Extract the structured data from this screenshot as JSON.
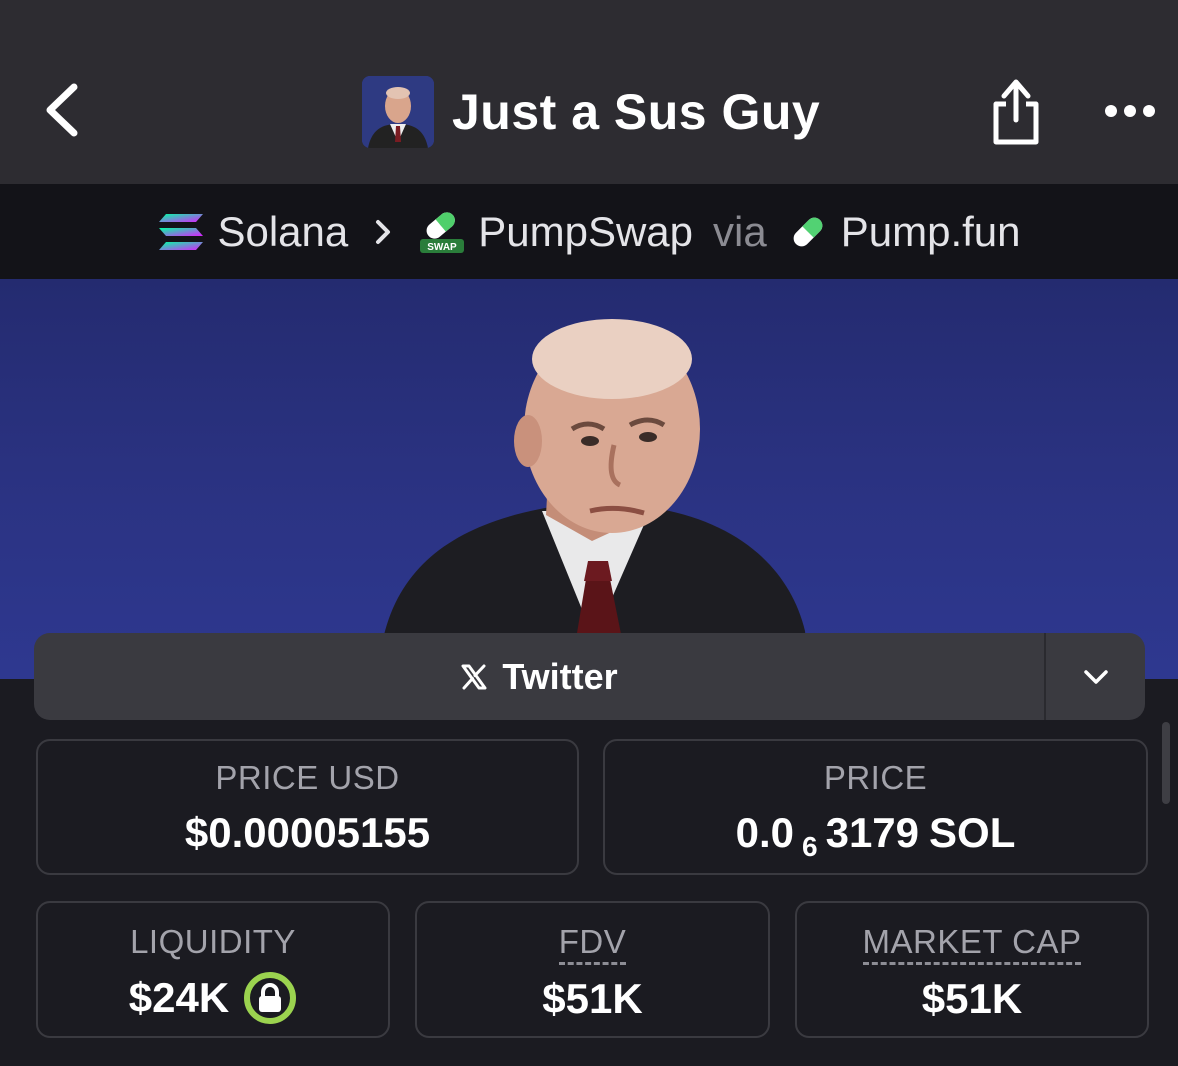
{
  "header": {
    "title": "Just a Sus Guy",
    "back_icon": "chevron-left-icon",
    "share_icon": "share-icon",
    "more_icon": "more-horizontal-icon"
  },
  "breadcrumb": {
    "chain": "Solana",
    "dex": "PumpSwap",
    "via_label": "via",
    "launchpad": "Pump.fun",
    "dex_badge_text": "SWAP"
  },
  "social": {
    "primary_label": "Twitter",
    "primary_icon": "x-logo-icon",
    "dropdown_icon": "chevron-down-icon"
  },
  "stats": {
    "price_usd": {
      "label": "PRICE USD",
      "value": "$0.00005155"
    },
    "price_native": {
      "label": "PRICE",
      "prefix": "0.0",
      "zeros": "6",
      "digits": "3179",
      "unit": "SOL"
    },
    "liquidity": {
      "label": "LIQUIDITY",
      "value": "$24K",
      "icon": "lock-icon"
    },
    "fdv": {
      "label": "FDV",
      "value": "$51K"
    },
    "market_cap": {
      "label": "MARKET CAP",
      "value": "$51K"
    }
  },
  "colors": {
    "header_bg": "#2d2c31",
    "breadcrumb_bg": "#131318",
    "banner_bg": "#2b3383",
    "lock_accent": "#9bd34f"
  }
}
